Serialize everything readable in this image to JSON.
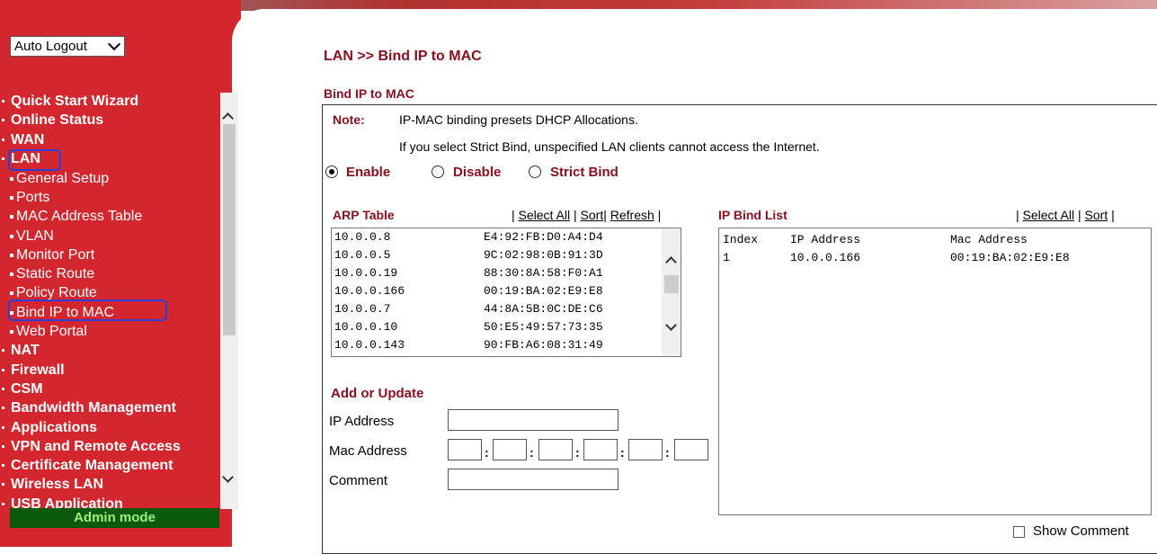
{
  "sidebar": {
    "auto_logout": "Auto Logout",
    "items": [
      {
        "label": "Quick Start Wizard"
      },
      {
        "label": "Online Status"
      },
      {
        "label": "WAN"
      },
      {
        "label": "LAN"
      },
      {
        "label": "General Setup"
      },
      {
        "label": "Ports"
      },
      {
        "label": "MAC Address Table"
      },
      {
        "label": "VLAN"
      },
      {
        "label": "Monitor Port"
      },
      {
        "label": "Static Route"
      },
      {
        "label": "Policy Route"
      },
      {
        "label": "Bind IP to MAC"
      },
      {
        "label": "Web Portal"
      },
      {
        "label": "NAT"
      },
      {
        "label": "Firewall"
      },
      {
        "label": "CSM"
      },
      {
        "label": "Bandwidth Management"
      },
      {
        "label": "Applications"
      },
      {
        "label": "VPN and Remote Access"
      },
      {
        "label": "Certificate Management"
      },
      {
        "label": "Wireless LAN"
      },
      {
        "label": "USB Application"
      }
    ],
    "mode": "Admin mode"
  },
  "page": {
    "title": "LAN >> Bind IP to MAC",
    "section": "Bind IP to MAC",
    "note_label": "Note:",
    "note_line1": "IP-MAC binding presets DHCP Allocations.",
    "note_line2": "If you select Strict Bind, unspecified LAN clients cannot access the Internet.",
    "modes": {
      "enable": "Enable",
      "disable": "Disable",
      "strict": "Strict Bind",
      "selected": "Enable"
    }
  },
  "arp": {
    "header": "ARP Table",
    "links": {
      "select_all": "Select All",
      "sort": "Sort",
      "refresh": "Refresh"
    },
    "rows": [
      {
        "ip": "10.0.0.8",
        "mac": "E4:92:FB:D0:A4:D4"
      },
      {
        "ip": "10.0.0.5",
        "mac": "9C:02:98:0B:91:3D"
      },
      {
        "ip": "10.0.0.19",
        "mac": "88:30:8A:58:F0:A1"
      },
      {
        "ip": "10.0.0.166",
        "mac": "00:19:BA:02:E9:E8"
      },
      {
        "ip": "10.0.0.7",
        "mac": "44:8A:5B:0C:DE:C6"
      },
      {
        "ip": "10.0.0.10",
        "mac": "50:E5:49:57:73:35"
      },
      {
        "ip": "10.0.0.143",
        "mac": "90:FB:A6:08:31:49"
      }
    ]
  },
  "bind": {
    "header": "IP Bind List",
    "links": {
      "select_all": "Select All",
      "sort": "Sort"
    },
    "columns": [
      "Index",
      "IP Address",
      "Mac Address"
    ],
    "rows": [
      {
        "index": "1",
        "ip": "10.0.0.166",
        "mac": "00:19:BA:02:E9:E8"
      }
    ]
  },
  "form": {
    "title": "Add or Update",
    "ip_label": "IP Address",
    "mac_label": "Mac Address",
    "comment_label": "Comment",
    "colon": ":",
    "ip_value": "",
    "comment_value": ""
  },
  "show_comment": "Show Comment",
  "colors": {
    "brand_red": "#d3262e",
    "heading_red": "#8a1020",
    "highlight": "#2a3ed8"
  }
}
